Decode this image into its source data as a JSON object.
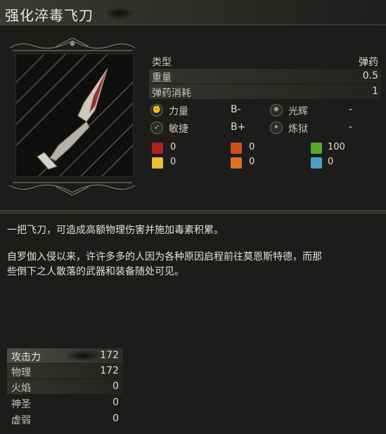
{
  "item": {
    "name": "强化淬毒飞刀",
    "description_lines": [
      "一把飞刀，可造成高额物理伤害并施加毒素积累。",
      "自罗伽入侵以来，许许多多的人因为各种原因启程前往莫恩斯特德，而那",
      "些倒下之人散落的武器和装备随处可见。"
    ]
  },
  "attributes": [
    {
      "label": "类型",
      "value": "弹药"
    },
    {
      "label": "重量",
      "value": "0.5"
    },
    {
      "label": "弹药消耗",
      "value": "1"
    }
  ],
  "scaling": [
    {
      "icon": "strength-icon",
      "label": "力量",
      "value": "B-"
    },
    {
      "icon": "radiance-icon",
      "label": "光辉",
      "value": "-"
    },
    {
      "icon": "agility-icon",
      "label": "敏捷",
      "value": "B+"
    },
    {
      "icon": "inferno-icon",
      "label": "炼狱",
      "value": "-"
    }
  ],
  "resistances": [
    {
      "icon": "bleed-icon",
      "value": "0",
      "color": "#b02020"
    },
    {
      "icon": "fire-icon",
      "value": "0",
      "color": "#d0501a"
    },
    {
      "icon": "poison-icon",
      "value": "100",
      "color": "#5aa82a"
    },
    {
      "icon": "holy-icon",
      "value": "0",
      "color": "#e8c030"
    },
    {
      "icon": "burn-icon",
      "value": "0",
      "color": "#e07020"
    },
    {
      "icon": "frost-icon",
      "value": "0",
      "color": "#4aa0c8"
    }
  ],
  "attack": {
    "header_label": "攻击力",
    "header_value": "172",
    "rows": [
      {
        "label": "物理",
        "value": "172"
      },
      {
        "label": "火焰",
        "value": "0"
      },
      {
        "label": "神圣",
        "value": "0"
      },
      {
        "label": "虚弱",
        "value": "0"
      }
    ]
  }
}
